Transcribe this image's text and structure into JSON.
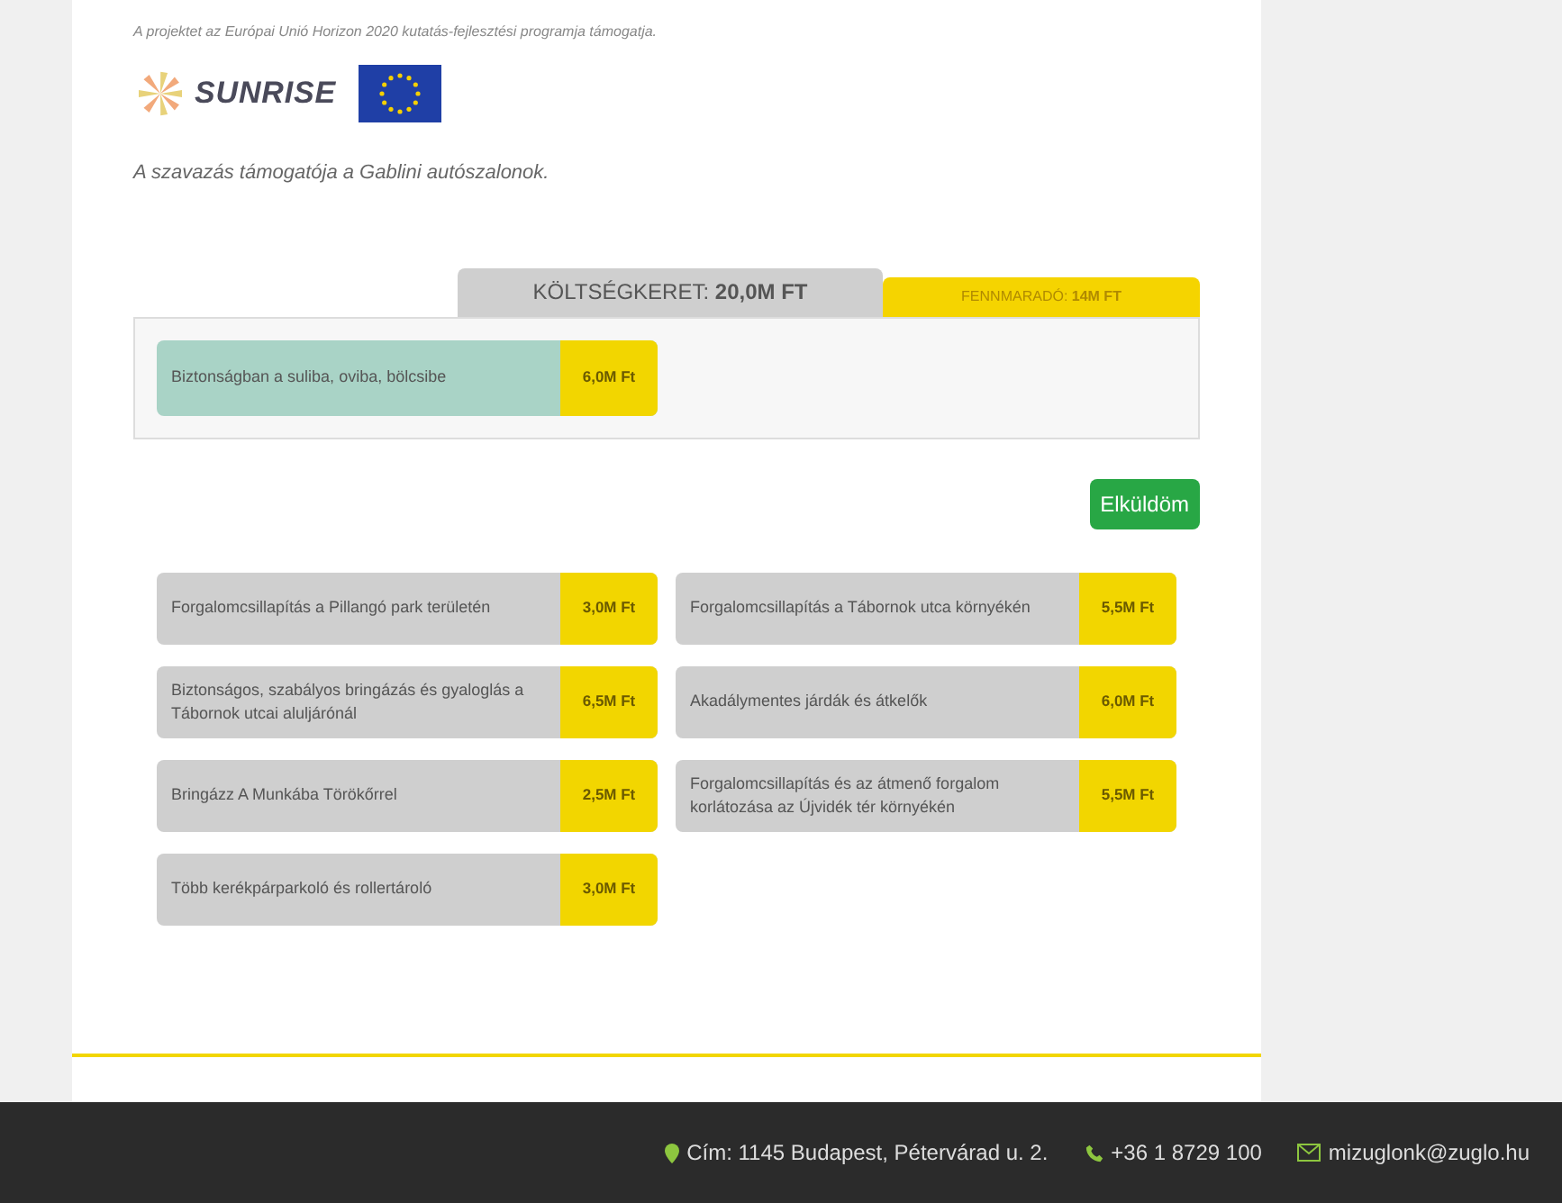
{
  "notice": "A projektet az Európai Unió Horizon 2020 kutatás-fejlesztési programja támogatja.",
  "logo": {
    "name": "SUNRISE"
  },
  "sponsor": "A szavazás támogatója a Gablini autószalonok.",
  "tabs": [
    {
      "label": "KÖLTSÉGKERET: **20,0M FT**",
      "selected": false
    },
    {
      "label": "FENNMARADÓ: **14M FT**",
      "selected": true
    }
  ],
  "chosen": [
    {
      "label": "Biztonságban a suliba, oviba, bölcsibe",
      "price": "6,0M Ft"
    }
  ],
  "submit_button": "Elküldöm",
  "projects": [
    {
      "label": "Forgalomcsillapítás a Pillangó park területén",
      "price": "3,0M Ft"
    },
    {
      "label": "Biztonságos, szabályos bringázás és gyaloglás a Tábornok utcai aluljárónál",
      "price": "6,5M Ft"
    },
    {
      "label": "Bringázz A Munkába Törökőrrel",
      "price": "2,5M Ft"
    },
    {
      "label": "Több kerékpárparkoló és rollertároló",
      "price": "3,0M Ft"
    },
    {
      "label": "Forgalomcsillapítás a Tábornok utca környékén",
      "price": "5,5M Ft"
    },
    {
      "label": "Akadálymentes járdák és átkelők",
      "price": "6,0M Ft"
    },
    {
      "label": "Forgalomcsillapítás és az átmenő forgalom korlátozása az Újvidék tér környékén",
      "price": "5,5M Ft"
    }
  ],
  "footer": {
    "address": "Cím: 1145 Budapest, Pétervárad u. 2.",
    "phone": "+36 1 8729 100",
    "email": "mizuglonk@zuglo.hu"
  }
}
